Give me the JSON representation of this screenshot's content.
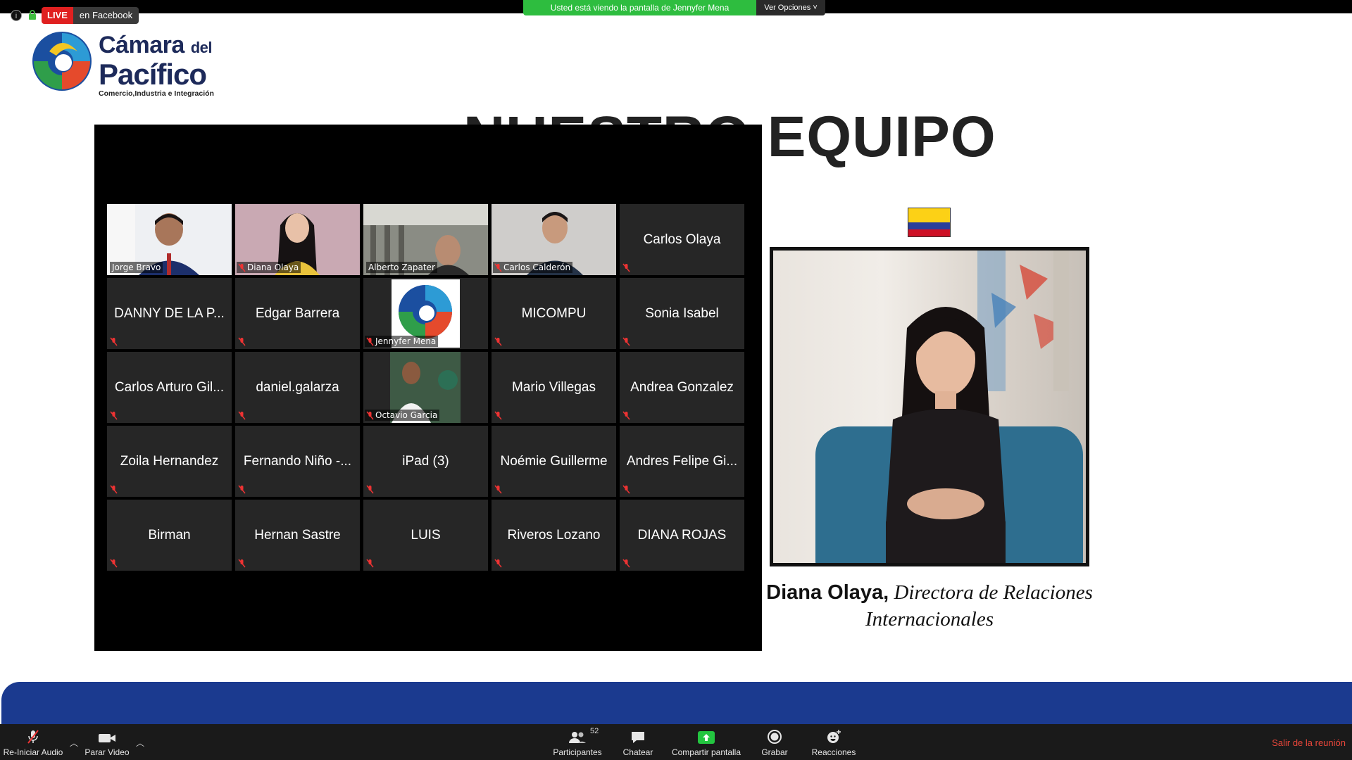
{
  "top_bar": {
    "live_label": "LIVE",
    "live_platform": "en Facebook",
    "share_banner": "Usted está viendo la pantalla de Jennyfer Mena",
    "view_options": "Ver Opciones ˅"
  },
  "slide": {
    "logo": {
      "line1": "Cámara",
      "line1_small": "del",
      "line2": "Pacífico",
      "tagline": "Comercio,Industria e Integración"
    },
    "title": "NUESTRO EQUIPO",
    "caption_name": "Diana Olaya,",
    "caption_role_1": "Directora de Relaciones",
    "caption_role_2": "Internacionales",
    "flag_colors": [
      "#fcd116",
      "#2a3e9a",
      "#ce1126"
    ]
  },
  "gallery": {
    "video_tiles": [
      {
        "name": "Jorge Bravo"
      },
      {
        "name": "Diana Olaya"
      },
      {
        "name": "Alberto Zapater"
      },
      {
        "name": "Carlos Calderón"
      }
    ],
    "name_tiles": [
      "Carlos Olaya",
      "DANNY DE LA P...",
      "Edgar Barrera",
      "MICOMPU",
      "Sonia Isabel",
      "Carlos Arturo Gil...",
      "daniel.galarza",
      "Mario Villegas",
      "Andrea Gonzalez",
      "Zoila Hernandez",
      "Fernando Niño -...",
      "iPad (3)",
      "Noémie Guillerme",
      "Andres Felipe Gi...",
      "Birman",
      "Hernan Sastre",
      "LUIS",
      "Riveros Lozano",
      "DIANA ROJAS"
    ],
    "logo_tile_name": "Jennyfer Mena",
    "photo_tile_name": "Octavio Garcia"
  },
  "toolbar": {
    "audio": "Re-Iniciar Audio",
    "video": "Parar Video",
    "participants": "Participantes",
    "participants_count": "52",
    "chat": "Chatear",
    "share": "Compartir pantalla",
    "record": "Grabar",
    "reactions": "Reacciones",
    "leave": "Salir de la reunión"
  }
}
